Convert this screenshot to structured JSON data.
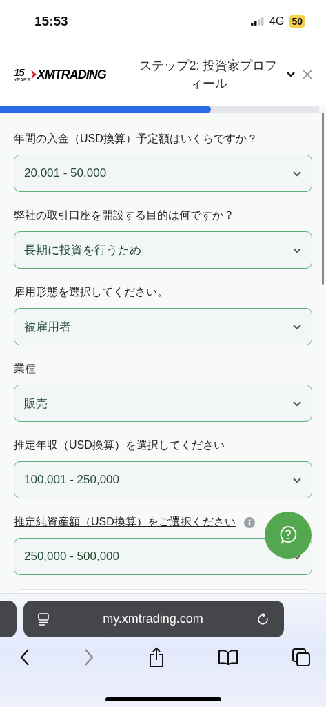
{
  "status_bar": {
    "time": "15:53",
    "network": "4G",
    "battery": "50"
  },
  "header": {
    "logo": {
      "years_number": "15",
      "years_label": "YEARS",
      "brand": "XMTRADING"
    },
    "title": "ステップ2: 投資家プロフィール"
  },
  "progress": {
    "level": 0.66
  },
  "fields": [
    {
      "label": "年間の入金（USD換算）予定額はいくらですか？",
      "value": "20,001 - 50,000",
      "underlined": false,
      "info": false
    },
    {
      "label": "弊社の取引口座を開設する目的は何ですか？",
      "value": "長期に投資を行うため",
      "underlined": false,
      "info": false
    },
    {
      "label": "雇用形態を選択してください。",
      "value": "被雇用者",
      "underlined": false,
      "info": false
    },
    {
      "label": "業種",
      "value": "販売",
      "underlined": false,
      "info": false
    },
    {
      "label": "推定年収（USD換算）を選択してください",
      "value": "100,001 - 250,000",
      "underlined": false,
      "info": false
    },
    {
      "label": "推定純資産額（USD換算）をご選択ください",
      "value": "250,000 - 500,000",
      "underlined": true,
      "info": true
    }
  ],
  "browser": {
    "url": "my.xmtrading.com"
  }
}
